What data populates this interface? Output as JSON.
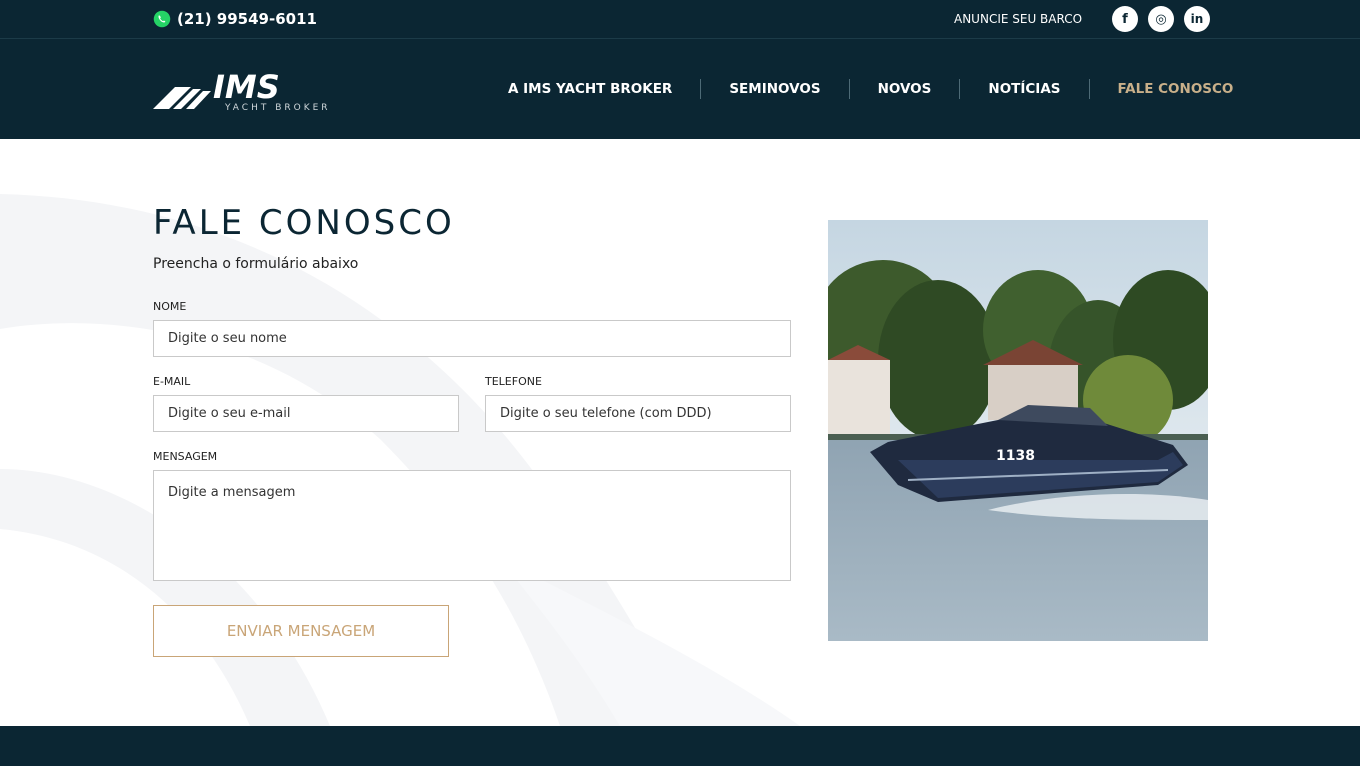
{
  "topbar": {
    "phone": "(21) 99549-6011",
    "announce": "ANUNCIE SEU BARCO",
    "socials": [
      {
        "icon": "facebook-icon",
        "glyph": "f"
      },
      {
        "icon": "instagram-icon",
        "glyph": "◎"
      },
      {
        "icon": "linkedin-icon",
        "glyph": "in"
      }
    ]
  },
  "header": {
    "logo_text": "IMS",
    "logo_subtext": "YACHT BROKER",
    "nav": [
      "A IMS YACHT BROKER",
      "SEMINOVOS",
      "NOVOS",
      "NOTÍCIAS",
      "FALE CONOSCO"
    ],
    "active_nav": "FALE CONOSCO"
  },
  "form": {
    "title": "FALE CONOSCO",
    "subtitle": "Preencha o formulário abaixo",
    "name_label": "NOME",
    "name_placeholder": "Digite o seu nome",
    "email_label": "E-MAIL",
    "email_placeholder": "Digite o seu e-mail",
    "phone_label": "TELEFONE",
    "phone_placeholder": "Digite o seu telefone (com DDD)",
    "message_label": "MENSAGEM",
    "message_placeholder": "Digite a mensagem",
    "submit_label": "ENVIAR MENSAGEM"
  },
  "photo": {
    "boat_number": "1138"
  },
  "colors": {
    "navy": "#0b2633",
    "gold": "#c9a577",
    "active_nav": "#c9b08a"
  }
}
